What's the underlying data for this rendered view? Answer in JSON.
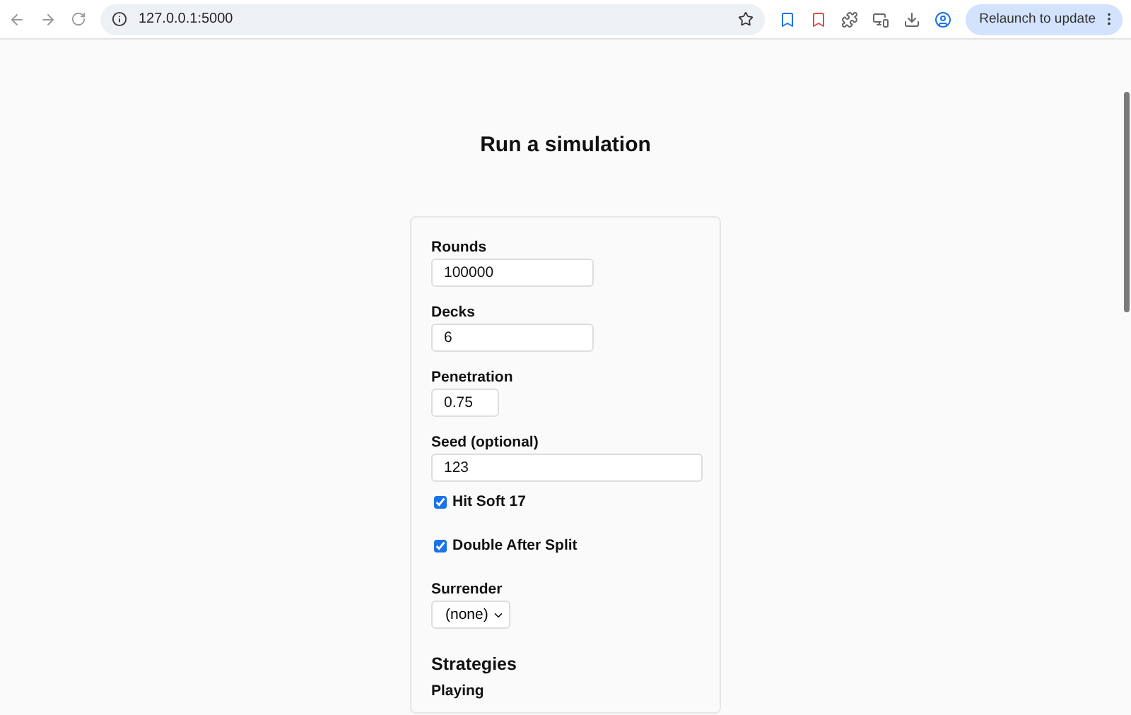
{
  "browser": {
    "url": "127.0.0.1:5000",
    "update_button": "Relaunch to update"
  },
  "page": {
    "title": "Run a simulation"
  },
  "form": {
    "fields": [
      {
        "kind": "text",
        "label": "Rounds",
        "value": "100000"
      },
      {
        "kind": "text",
        "label": "Decks",
        "value": "6"
      },
      {
        "kind": "text",
        "label": "Penetration",
        "value": "0.75"
      },
      {
        "kind": "text",
        "label": "Seed (optional)",
        "value": "123"
      },
      {
        "kind": "checkbox",
        "label": "Hit Soft 17",
        "checked": true
      },
      {
        "kind": "checkbox",
        "label": "Double After Split",
        "checked": true
      },
      {
        "kind": "select",
        "label": "Surrender",
        "value": "(none)"
      }
    ],
    "section_title": "Strategies",
    "sub_label": "Playing"
  }
}
